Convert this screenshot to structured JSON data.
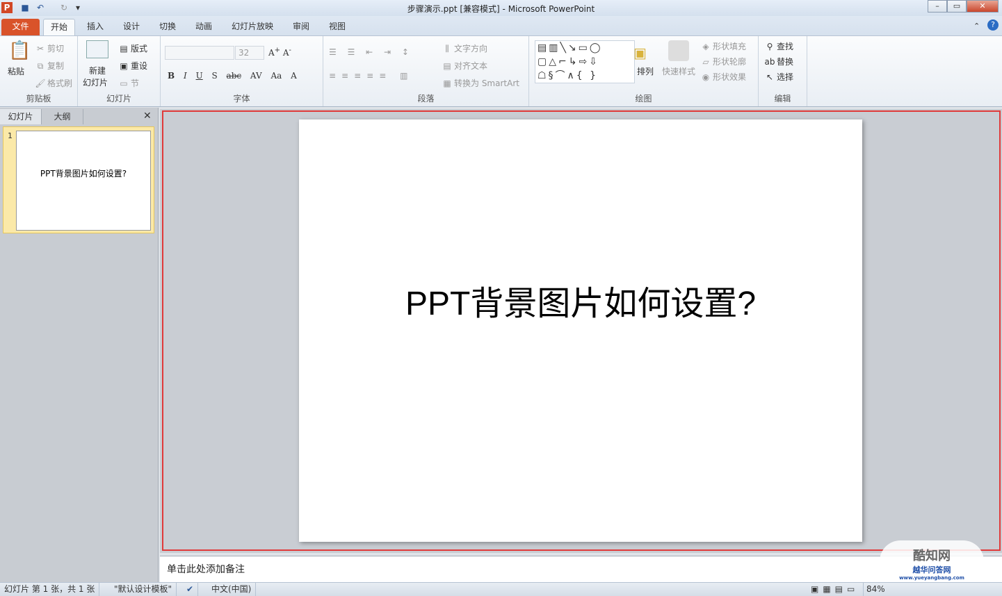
{
  "window": {
    "title": "步骤演示.ppt [兼容模式]  -  Microsoft PowerPoint"
  },
  "tabs": [
    "文件",
    "开始",
    "插入",
    "设计",
    "切换",
    "动画",
    "幻灯片放映",
    "审阅",
    "视图"
  ],
  "ribbon": {
    "clipboard": {
      "label": "剪贴板",
      "paste": "粘贴",
      "cut": "剪切",
      "copy": "复制",
      "format_painter": "格式刷"
    },
    "slides": {
      "label": "幻灯片",
      "new_slide_1": "新建",
      "new_slide_2": "幻灯片",
      "layout": "版式",
      "reset": "重设",
      "section": "节"
    },
    "font": {
      "label": "字体",
      "font_name": "",
      "font_size": "32"
    },
    "paragraph": {
      "label": "段落",
      "text_direction": "文字方向",
      "align_text": "对齐文本",
      "smartart": "转换为 SmartArt"
    },
    "drawing": {
      "label": "绘图",
      "arrange": "排列",
      "quick_styles": "快速样式",
      "shape_fill": "形状填充",
      "shape_outline": "形状轮廓",
      "shape_effects": "形状效果"
    },
    "editing": {
      "label": "编辑",
      "find": "查找",
      "replace": "替换",
      "select": "选择"
    }
  },
  "left_pane": {
    "tab_slides": "幻灯片",
    "tab_outline": "大纲",
    "slide_number": "1",
    "thumb_text": "PPT背景图片如何设置?"
  },
  "slide": {
    "title": "PPT背景图片如何设置?"
  },
  "notes": {
    "placeholder": "单击此处添加备注"
  },
  "status": {
    "slide_info": "幻灯片 第 1 张，共 1 张",
    "theme": "\"默认设计模板\"",
    "language": "中文(中国)",
    "zoom": "84%"
  },
  "watermark": {
    "text1": "酷知网",
    "text2": "越华问答网",
    "url": "www.yueyangbang.com"
  }
}
